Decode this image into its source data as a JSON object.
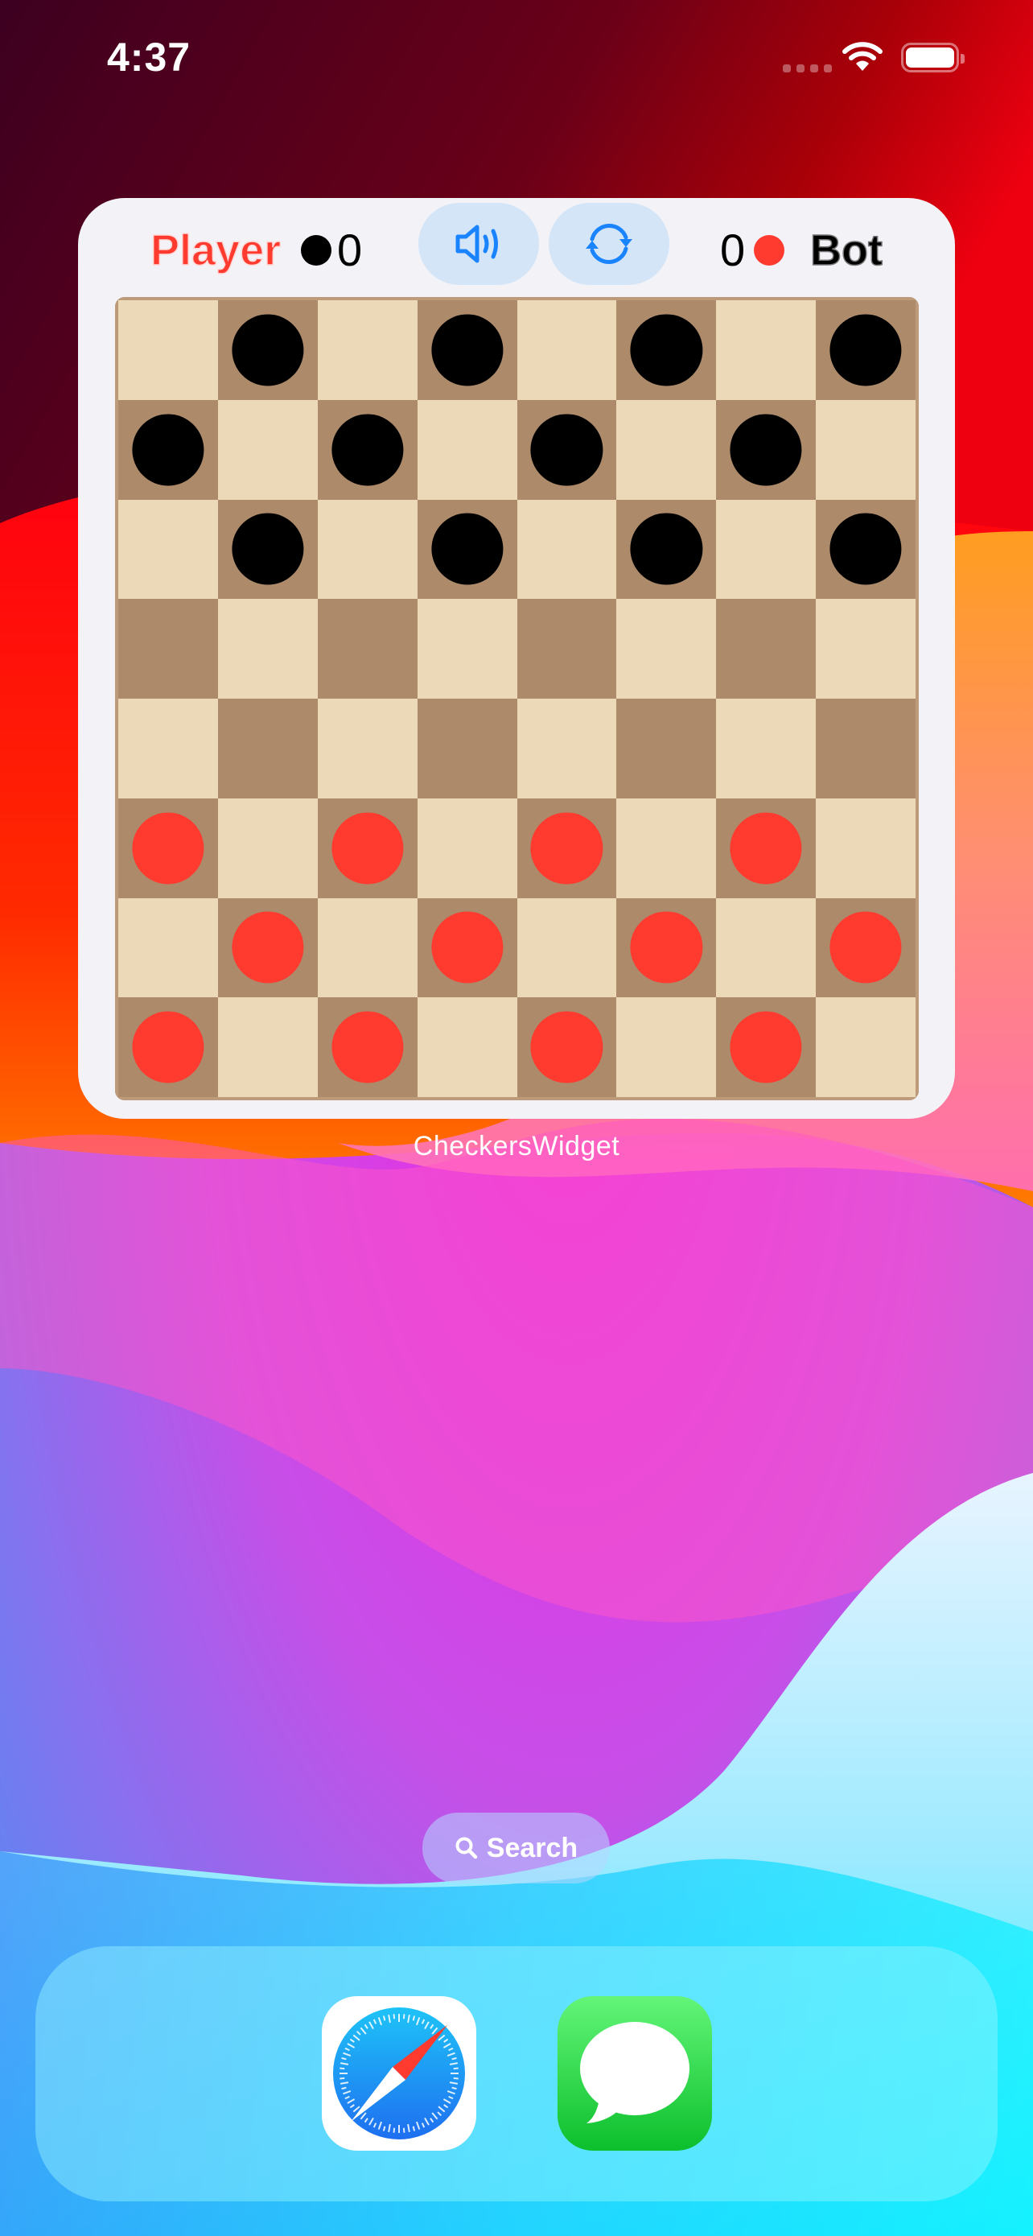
{
  "status_bar": {
    "time": "4:37",
    "signal_icon": "cellular-signal-icon",
    "wifi_icon": "wifi-icon",
    "battery_icon": "battery-icon"
  },
  "widget": {
    "app_name": "CheckersWidget",
    "player": {
      "label": "Player",
      "score": "0",
      "color": "#ff3b30",
      "piece_color": "#000000"
    },
    "bot": {
      "label": "Bot",
      "score": "0",
      "piece_color": "#ff3b30"
    },
    "buttons": {
      "sound": {
        "icon": "speaker-wave-icon"
      },
      "reset": {
        "icon": "arrow-clockwise-rotate-icon"
      }
    },
    "board": {
      "size": 8,
      "light_color": "#ebd9b8",
      "dark_color": "#ac8a6a",
      "rows": [
        ". b . b . b . b",
        "b . b . b . b .",
        ". b . b . b . b",
        ". . . . . . . .",
        ". . . . . . . .",
        "r . r . r . r .",
        ". r . r . r . r",
        "r . r . r . r ."
      ],
      "piece_colors": {
        "b": "#000000",
        "r": "#ff3b30"
      }
    }
  },
  "search": {
    "label": "Search",
    "icon": "magnifying-glass-icon"
  },
  "dock": {
    "apps": [
      {
        "name": "Safari",
        "icon": "safari-compass-icon"
      },
      {
        "name": "Messages",
        "icon": "messages-bubble-icon"
      }
    ]
  }
}
